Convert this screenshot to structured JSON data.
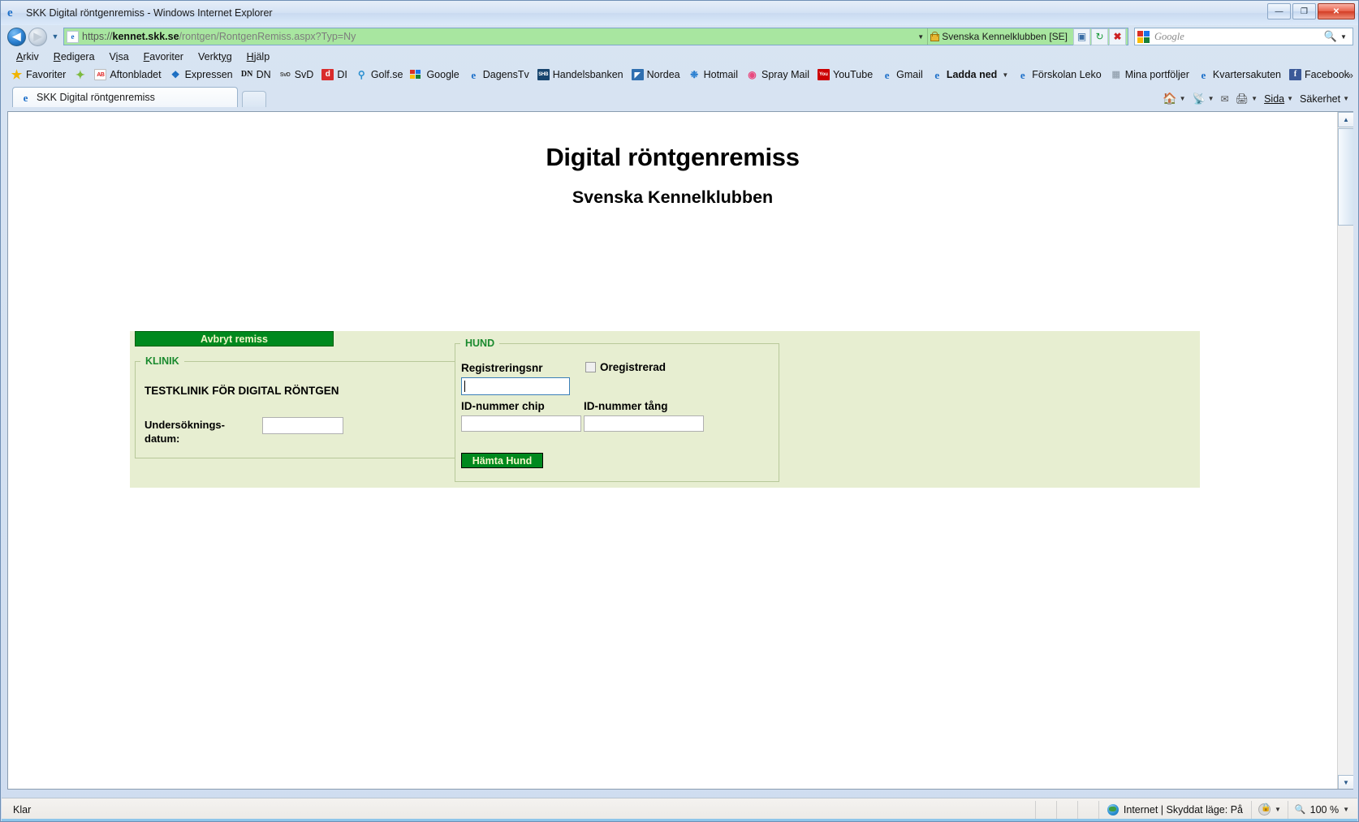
{
  "window": {
    "title": "SKK Digital röntgenremiss - Windows Internet Explorer",
    "minimize_label": "—",
    "maximize_label": "❐",
    "close_label": "✕"
  },
  "navigation": {
    "back_label": "◀",
    "forward_label": "▶",
    "recent_pages_caret": "▼",
    "address": {
      "scheme": "https://",
      "host": "kennet.skk.se",
      "path": "/rontgen/RontgenRemiss.aspx?Typ=Ny",
      "full": "https://kennet.skk.se/rontgen/RontgenRemiss.aspx?Typ=Ny"
    },
    "security_org": "Svenska Kennelklubben [SE]",
    "compat_button": "compat-view-icon",
    "refresh_button": "refresh-icon",
    "stop_button": "stop-icon",
    "search": {
      "placeholder": "Google",
      "provider_icon": "google-icon",
      "submit_icon": "search-icon"
    }
  },
  "menubar": {
    "items": [
      {
        "label": "Arkiv",
        "accel": "A"
      },
      {
        "label": "Redigera",
        "accel": "R"
      },
      {
        "label": "Visa",
        "accel": "i"
      },
      {
        "label": "Favoriter",
        "accel": "F"
      },
      {
        "label": "Verktyg",
        "accel": "y"
      },
      {
        "label": "Hjälp",
        "accel": "H"
      }
    ]
  },
  "favorites_bar": {
    "favorites_button": "Favoriter",
    "items": [
      {
        "label": "Aftonbladet",
        "icon": "aftonbladet-icon",
        "bold": false
      },
      {
        "label": "Expressen",
        "icon": "expressen-icon",
        "bold": false
      },
      {
        "label": "DN",
        "icon": "dn-icon",
        "bold": false
      },
      {
        "label": "SvD",
        "icon": "svd-icon",
        "bold": false
      },
      {
        "label": "DI",
        "icon": "di-icon",
        "bold": false
      },
      {
        "label": "Golf.se",
        "icon": "golf-icon",
        "bold": false
      },
      {
        "label": "Google",
        "icon": "google-icon",
        "bold": false
      },
      {
        "label": "DagensTv",
        "icon": "dagenstv-icon",
        "bold": false
      },
      {
        "label": "Handelsbanken",
        "icon": "handelsbanken-icon",
        "bold": false
      },
      {
        "label": "Nordea",
        "icon": "nordea-icon",
        "bold": false
      },
      {
        "label": "Hotmail",
        "icon": "hotmail-icon",
        "bold": false
      },
      {
        "label": "Spray Mail",
        "icon": "spray-icon",
        "bold": false
      },
      {
        "label": "YouTube",
        "icon": "youtube-icon",
        "bold": false
      },
      {
        "label": "Gmail",
        "icon": "ie-page-icon",
        "bold": false
      },
      {
        "label": "Ladda ned",
        "icon": "ie-page-icon",
        "bold": true,
        "caret": "▼"
      },
      {
        "label": "Förskolan Leko",
        "icon": "ie-page-icon",
        "bold": false
      },
      {
        "label": "Mina portföljer",
        "icon": "grid-icon",
        "bold": false
      },
      {
        "label": "Kvartersakuten",
        "icon": "ie-page-icon",
        "bold": false
      },
      {
        "label": "Facebook",
        "icon": "facebook-icon",
        "bold": false
      }
    ],
    "overflow_label": "»"
  },
  "tabs": [
    {
      "label": "SKK Digital röntgenremiss",
      "icon": "ie-page-icon",
      "active": true
    }
  ],
  "new_tab_label": "",
  "command_bar": {
    "home_label": "",
    "feeds_label": "",
    "mail_label": "",
    "print_label": "",
    "page_label": "Sida",
    "safety_label": "Säkerhet",
    "caret": "▼"
  },
  "page": {
    "title": "Digital röntgenremiss",
    "subtitle": "Svenska Kennelklubben",
    "clinic_panel": {
      "cancel_button": "Avbryt remiss",
      "legend": "KLINIK",
      "clinic_name": "TESTKLINIK FÖR DIGITAL RÖNTGEN",
      "date_label": "Undersöknings-\ndatum:",
      "date_label_line1": "Undersöknings-",
      "date_label_line2": "datum:",
      "date_value": "",
      "date_placeholder": ""
    },
    "dog_panel": {
      "legend": "HUND",
      "regnr_label": "Registreringsnr",
      "regnr_value": "",
      "unregistered_label": "Oregistrerad",
      "unregistered_checked": false,
      "chip_label": "ID-nummer chip",
      "chip_value": "",
      "tang_label": "ID-nummer tång",
      "tang_value": "",
      "fetch_button": "Hämta Hund"
    }
  },
  "statusbar": {
    "status_text": "Klar",
    "zone_text": "Internet | Skyddat läge: På",
    "zone_icon": "internet-globe-icon",
    "protected_icon": "protected-mode-icon",
    "zoom_level": "100 %",
    "caret": "▼"
  },
  "colors": {
    "brand_green": "#00891e",
    "panel_bg": "#e7eed1",
    "legend_green": "#1a8a2e",
    "ev_address_green": "#a8e6a0",
    "button_text": "#f2f6c8"
  }
}
